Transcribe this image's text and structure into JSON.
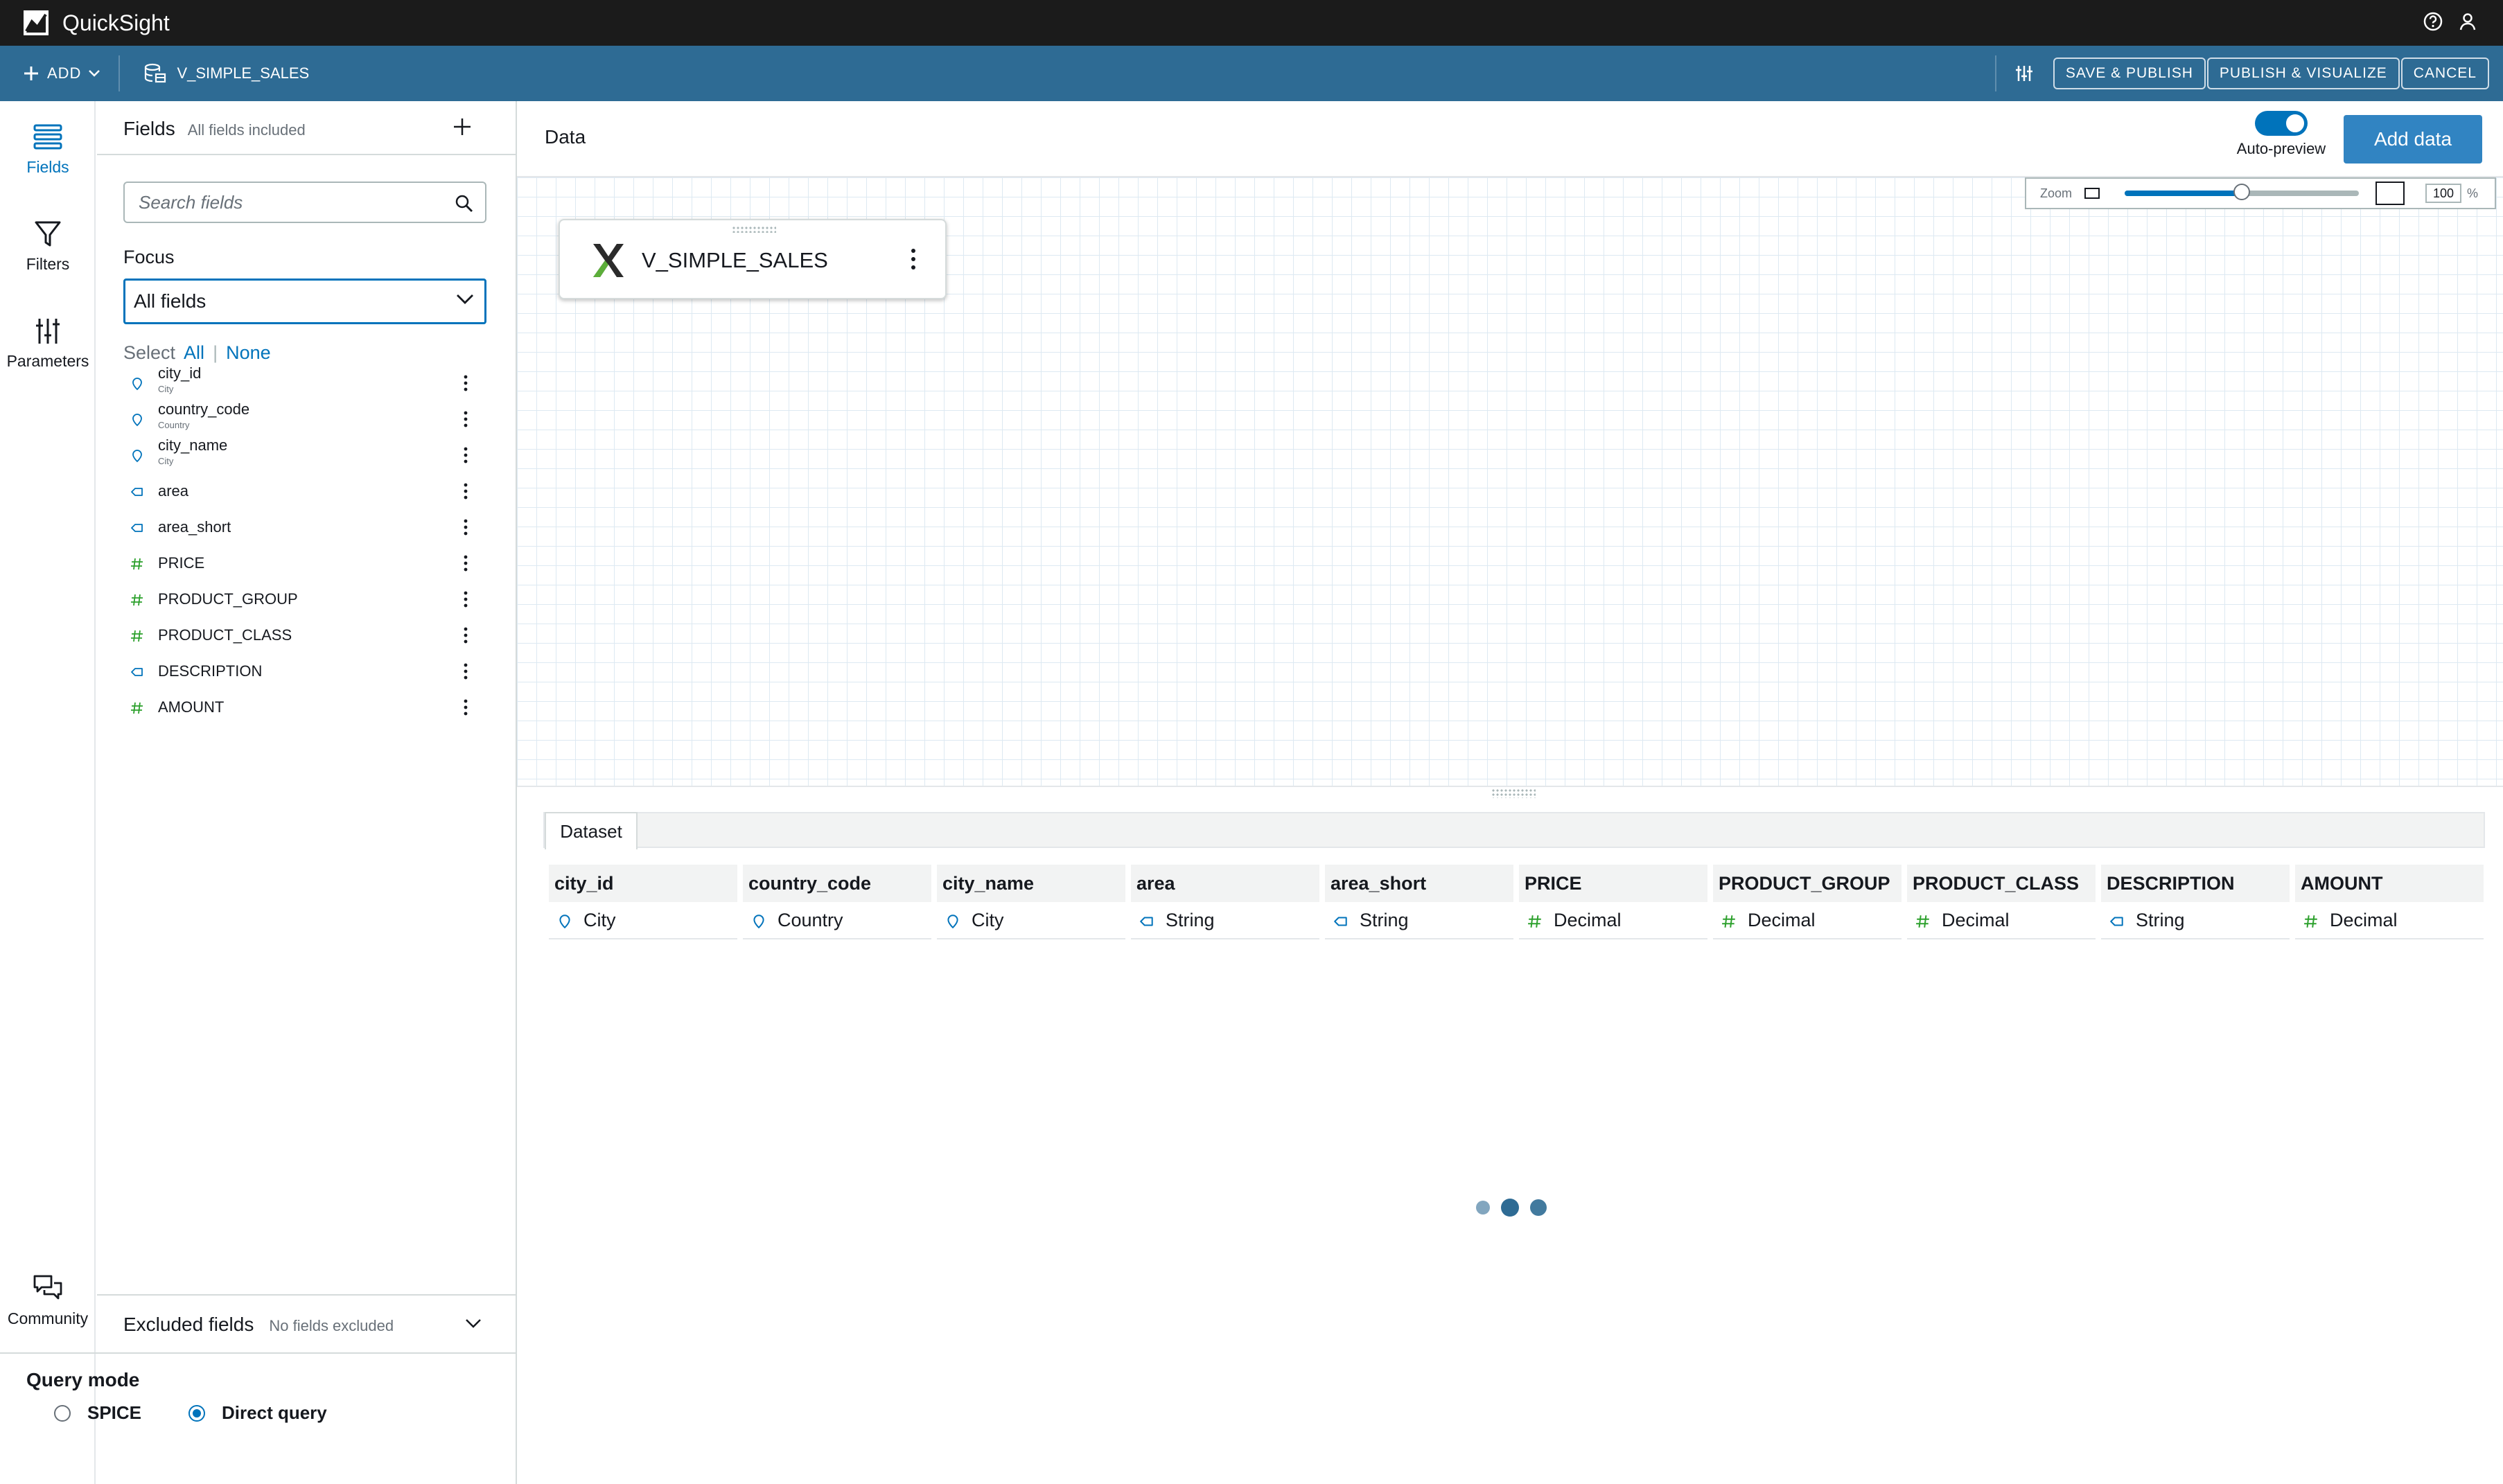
{
  "titlebar": {
    "app_name": "QuickSight",
    "help_icon": "help-circle-icon",
    "user_icon": "user-icon"
  },
  "toolbar": {
    "add_label": "ADD",
    "dataset_name": "V_SIMPLE_SALES",
    "save_publish": "SAVE & PUBLISH",
    "publish_visualize": "PUBLISH & VISUALIZE",
    "cancel": "CANCEL"
  },
  "rail": {
    "fields": "Fields",
    "filters": "Filters",
    "parameters": "Parameters",
    "community": "Community"
  },
  "fields_panel": {
    "title": "Fields",
    "subtitle": "All fields included",
    "search_placeholder": "Search fields",
    "focus_label": "Focus",
    "focus_value": "All fields",
    "select_label": "Select",
    "select_all": "All",
    "select_none": "None",
    "items": [
      {
        "name": "city_id",
        "sub": "City",
        "type": "geo"
      },
      {
        "name": "country_code",
        "sub": "Country",
        "type": "geo"
      },
      {
        "name": "city_name",
        "sub": "City",
        "type": "geo"
      },
      {
        "name": "area",
        "sub": "",
        "type": "string"
      },
      {
        "name": "area_short",
        "sub": "",
        "type": "string"
      },
      {
        "name": "PRICE",
        "sub": "",
        "type": "decimal"
      },
      {
        "name": "PRODUCT_GROUP",
        "sub": "",
        "type": "decimal"
      },
      {
        "name": "PRODUCT_CLASS",
        "sub": "",
        "type": "decimal"
      },
      {
        "name": "DESCRIPTION",
        "sub": "",
        "type": "string"
      },
      {
        "name": "AMOUNT",
        "sub": "",
        "type": "decimal"
      }
    ],
    "excluded_title": "Excluded fields",
    "excluded_subtitle": "No fields excluded"
  },
  "query_mode": {
    "title": "Query mode",
    "option_spice": "SPICE",
    "option_direct": "Direct query",
    "selected": "Direct query"
  },
  "main": {
    "data_label": "Data",
    "auto_preview_label": "Auto-preview",
    "auto_preview_on": true,
    "add_data": "Add data",
    "zoom_label": "Zoom",
    "zoom_percent": "100",
    "zoom_percent_sign": "%",
    "zoom_slider_fraction": 0.5,
    "dataset_card": "V_SIMPLE_SALES",
    "dataset_tab": "Dataset"
  },
  "columns": [
    {
      "name": "city_id",
      "type": "City",
      "kind": "geo"
    },
    {
      "name": "country_code",
      "type": "Country",
      "kind": "geo"
    },
    {
      "name": "city_name",
      "type": "City",
      "kind": "geo"
    },
    {
      "name": "area",
      "type": "String",
      "kind": "string"
    },
    {
      "name": "area_short",
      "type": "String",
      "kind": "string"
    },
    {
      "name": "PRICE",
      "type": "Decimal",
      "kind": "decimal"
    },
    {
      "name": "PRODUCT_GROUP",
      "type": "Decimal",
      "kind": "decimal"
    },
    {
      "name": "PRODUCT_CLASS",
      "type": "Decimal",
      "kind": "decimal"
    },
    {
      "name": "DESCRIPTION",
      "type": "String",
      "kind": "string"
    },
    {
      "name": "AMOUNT",
      "type": "Decimal",
      "kind": "decimal"
    }
  ],
  "colors": {
    "accent": "#0073bb",
    "toolbar": "#2e6b94",
    "geo_icon": "#0073bb",
    "string_icon": "#0073bb",
    "decimal_icon": "#2ca02c"
  }
}
